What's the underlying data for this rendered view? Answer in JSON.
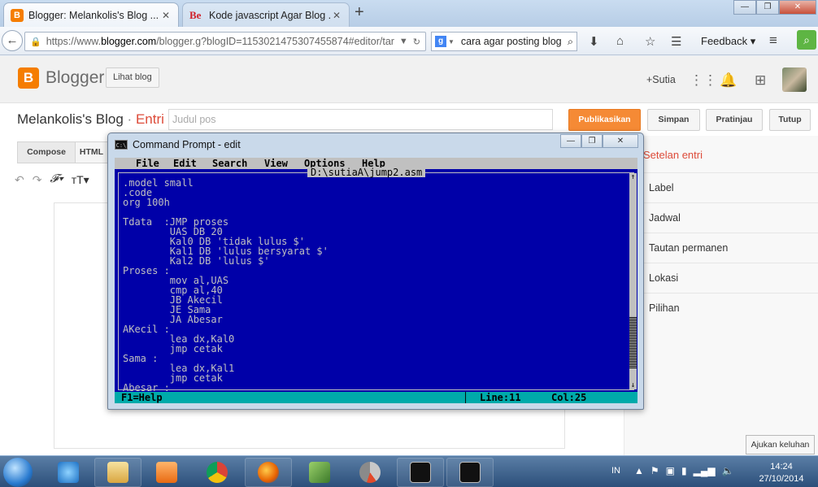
{
  "browser": {
    "tabs": [
      {
        "title": "Blogger: Melankolis's Blog ...",
        "favicon": "blogger-icon"
      },
      {
        "title": "Kode javascript Agar Blog ...",
        "favicon": "behance-icon"
      }
    ],
    "url_prefix": "https://www.",
    "url_domain": "blogger.com",
    "url_rest": "/blogger.g?blogID=1153021475307455874#editor/target=",
    "search_text": "cara agar posting blog",
    "feedback_label": "Feedback"
  },
  "blogger": {
    "brand": "Blogger",
    "view_blog_label": "Lihat blog",
    "user_label": "+Sutia",
    "blog_name": "Melankolis's Blog",
    "separator": "·",
    "section": "Entri",
    "title_placeholder": "Judul pos",
    "buttons": {
      "publish": "Publikasikan",
      "save": "Simpan",
      "preview": "Pratinjau",
      "close": "Tutup"
    },
    "editor_tabs": {
      "compose": "Compose",
      "html": "HTML"
    },
    "settings": {
      "heading": "Setelan entri",
      "items": [
        "Label",
        "Jadwal",
        "Tautan permanen",
        "Lokasi",
        "Pilihan"
      ]
    },
    "tooltip": "Ajukan keluhan"
  },
  "cmd": {
    "title": "Command Prompt - edit",
    "menu": [
      "File",
      "Edit",
      "Search",
      "View",
      "Options",
      "Help"
    ],
    "filename": "D:\\sutiaA\\jump2.asm",
    "code_lines": [
      ".model small",
      ".code",
      "org 100h",
      "",
      "Tdata  :JMP proses",
      "        UAS DB 20",
      "        Kal0 DB 'tidak lulus $'",
      "        Kal1 DB 'lulus bersyarat $'",
      "        Kal2 DB 'lulus $'",
      "Proses :",
      "        mov al,UAS",
      "        cmp al,40",
      "        JB Akecil",
      "        JE Sama",
      "        JA Abesar",
      "AKecil :",
      "        lea dx,Kal0",
      "        jmp cetak",
      "Sama :",
      "        lea dx,Kal1",
      "        jmp cetak",
      "Abesar :"
    ],
    "status_help": "F1=Help",
    "status_line": "Line:11",
    "status_col": "Col:25"
  },
  "taskbar": {
    "language": "IN",
    "time": "14:24",
    "date": "27/10/2014"
  },
  "colors": {
    "blogger_orange": "#f57d00",
    "publish_button": "#f58a35",
    "dos_background": "#0000a8",
    "dos_text": "#c0c0c0",
    "dos_statusbar": "#00aaaa"
  }
}
